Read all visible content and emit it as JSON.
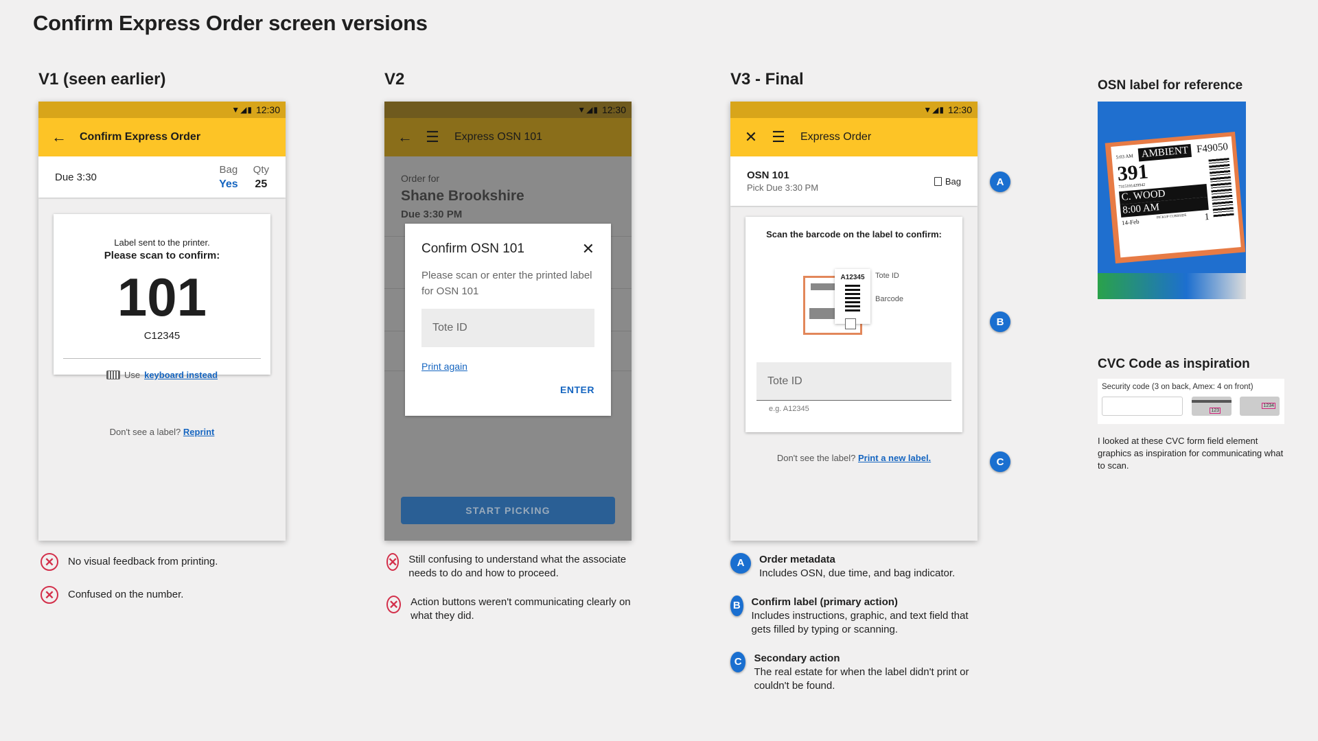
{
  "page_title": "Confirm Express Order screen versions",
  "status_time": "12:30",
  "v1": {
    "heading": "V1 (seen earlier)",
    "appbar_title": "Confirm Express Order",
    "due": "Due 3:30",
    "bag_label": "Bag",
    "bag_value": "Yes",
    "qty_label": "Qty",
    "qty_value": "25",
    "line1": "Label sent to the printer.",
    "line2": "Please scan to confirm:",
    "big_number": "101",
    "code": "C12345",
    "use_text": "Use",
    "keyboard_link": "keyboard instead",
    "footer_text": "Don't see a label?",
    "reprint_link": "Reprint",
    "notes": [
      "No visual feedback from printing.",
      "Confused on the number."
    ]
  },
  "v2": {
    "heading": "V2",
    "appbar_title": "Express OSN 101",
    "order_for": "Order for",
    "customer": "Shane Brookshire",
    "due": "Due 3:30 PM",
    "dialog_title": "Confirm OSN 101",
    "dialog_body": "Please scan or enter the printed label for OSN 101",
    "field_placeholder": "Tote ID",
    "print_again": "Print again",
    "enter_button": "ENTER",
    "start_button": "START PICKING",
    "notes": [
      "Still confusing to understand what the associate needs to do and how to proceed.",
      "Action buttons weren't communicating clearly on what they did."
    ]
  },
  "v3": {
    "heading": "V3 - Final",
    "appbar_title": "Express Order",
    "osn": "OSN 101",
    "pick_due": "Pick Due 3:30 PM",
    "bag_label": "Bag",
    "scan_instruction": "Scan the barcode on the label to confirm:",
    "label_code": "A12345",
    "tote_id_caption": "Tote ID",
    "barcode_caption": "Barcode",
    "field_placeholder": "Tote ID",
    "field_hint": "e.g. A12345",
    "footer_text": "Don't see the label?",
    "print_new_link": "Print a new label.",
    "annotations": [
      {
        "badge": "A",
        "title": "Order metadata",
        "body": "Includes OSN, due time, and bag indicator."
      },
      {
        "badge": "B",
        "title": "Confirm label (primary action)",
        "body": "Includes instructions, graphic, and text field that gets filled by typing or scanning."
      },
      {
        "badge": "C",
        "title": "Secondary action",
        "body": "The real estate for when the label didn't print or couldn't be found."
      }
    ]
  },
  "reference": {
    "osn_heading": "OSN label for reference",
    "label_ambient": "AMBIENT",
    "label_code": "F49050",
    "label_time_small": "5:03 AM",
    "label_osn": "391",
    "label_order": "7315191429942",
    "label_name": "C. WOOD",
    "label_time": "8:00 AM",
    "label_date": "14-Feb",
    "label_pickup": "PICKUP CURBSIDE",
    "label_load": "1",
    "cvc_heading": "CVC Code as inspiration",
    "cvc_field_label": "Security code (3 on back, Amex: 4 on front)",
    "cvc_card1": "123",
    "cvc_card2": "1234",
    "cvc_note": "I looked at these CVC form field element graphics as inspiration for communicating what to scan."
  }
}
